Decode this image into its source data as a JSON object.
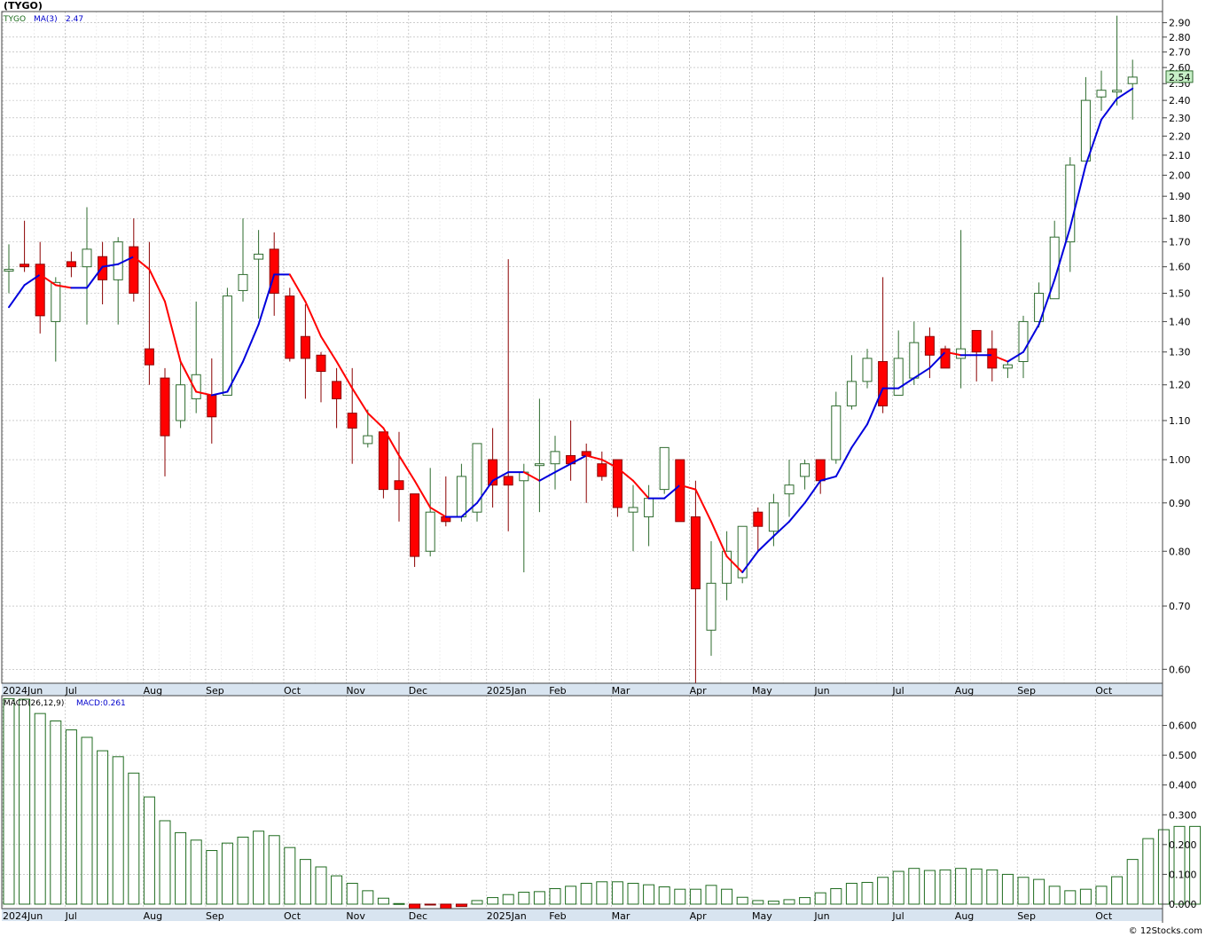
{
  "header": {
    "title": "(TYGO)"
  },
  "legend": {
    "symbol": "TYGO",
    "ma_label": "MA(3)",
    "ma_value": "2.47",
    "macd_params": "MACD(26,12,9)",
    "macd_value": "MACD:0.261"
  },
  "last_price_label": "2.54",
  "watermark": "© 12Stocks.com",
  "colors": {
    "up": "#2e6b2e",
    "down": "#ff0000",
    "ma_up": "#0000dd",
    "ma_down": "#ff0000",
    "macd_bar": "#1f6b1f",
    "price_box": "#c8f0c8",
    "axis_band": "#d8e4f0"
  },
  "chart_data": [
    {
      "type": "candlestick",
      "symbol": "TYGO",
      "scale": "log",
      "ylim": [
        0.58,
        2.98
      ],
      "yticks": [
        0.6,
        0.7,
        0.8,
        0.9,
        1.0,
        1.1,
        1.2,
        1.3,
        1.4,
        1.5,
        1.6,
        1.7,
        1.8,
        1.9,
        2.0,
        2.1,
        2.2,
        2.3,
        2.4,
        2.5,
        2.6,
        2.7,
        2.8,
        2.9
      ],
      "ytick_labels": [
        "0.60",
        "0.70",
        "0.80",
        "0.90",
        "1.00",
        "1.10",
        "1.20",
        "1.30",
        "1.40",
        "1.50",
        "1.60",
        "1.70",
        "1.80",
        "1.90",
        "2.00",
        "2.10",
        "2.20",
        "2.30",
        "2.40",
        "2.50",
        "2.60",
        "2.70",
        "2.80",
        "2.90"
      ],
      "months": [
        {
          "label": "2024Jun",
          "week": 0
        },
        {
          "label": "Jul",
          "week": 4
        },
        {
          "label": "Aug",
          "week": 9
        },
        {
          "label": "Sep",
          "week": 13
        },
        {
          "label": "Oct",
          "week": 18
        },
        {
          "label": "Nov",
          "week": 22
        },
        {
          "label": "Dec",
          "week": 26
        },
        {
          "label": "2025Jan",
          "week": 31
        },
        {
          "label": "Feb",
          "week": 35
        },
        {
          "label": "Mar",
          "week": 39
        },
        {
          "label": "Apr",
          "week": 44
        },
        {
          "label": "May",
          "week": 48
        },
        {
          "label": "Jun",
          "week": 52
        },
        {
          "label": "Jul",
          "week": 57
        },
        {
          "label": "Aug",
          "week": 61
        },
        {
          "label": "Sep",
          "week": 65
        },
        {
          "label": "Oct",
          "week": 70
        }
      ],
      "candles": [
        {
          "o": 1.59,
          "h": 1.69,
          "l": 1.5,
          "c": 1.59
        },
        {
          "o": 1.61,
          "h": 1.79,
          "l": 1.58,
          "c": 1.6
        },
        {
          "o": 1.61,
          "h": 1.7,
          "l": 1.36,
          "c": 1.42
        },
        {
          "o": 1.4,
          "h": 1.56,
          "l": 1.27,
          "c": 1.54
        },
        {
          "o": 1.62,
          "h": 1.66,
          "l": 1.56,
          "c": 1.6
        },
        {
          "o": 1.6,
          "h": 1.85,
          "l": 1.39,
          "c": 1.67
        },
        {
          "o": 1.64,
          "h": 1.7,
          "l": 1.46,
          "c": 1.55
        },
        {
          "o": 1.55,
          "h": 1.72,
          "l": 1.39,
          "c": 1.7
        },
        {
          "o": 1.68,
          "h": 1.8,
          "l": 1.47,
          "c": 1.5
        },
        {
          "o": 1.31,
          "h": 1.7,
          "l": 1.2,
          "c": 1.26
        },
        {
          "o": 1.22,
          "h": 1.25,
          "l": 0.96,
          "c": 1.06
        },
        {
          "o": 1.1,
          "h": 1.27,
          "l": 1.08,
          "c": 1.2
        },
        {
          "o": 1.16,
          "h": 1.47,
          "l": 1.12,
          "c": 1.23
        },
        {
          "o": 1.17,
          "h": 1.28,
          "l": 1.04,
          "c": 1.11
        },
        {
          "o": 1.17,
          "h": 1.52,
          "l": 1.17,
          "c": 1.49
        },
        {
          "o": 1.51,
          "h": 1.8,
          "l": 1.47,
          "c": 1.57
        },
        {
          "o": 1.63,
          "h": 1.75,
          "l": 1.41,
          "c": 1.65
        },
        {
          "o": 1.67,
          "h": 1.74,
          "l": 1.42,
          "c": 1.5
        },
        {
          "o": 1.49,
          "h": 1.52,
          "l": 1.27,
          "c": 1.28
        },
        {
          "o": 1.35,
          "h": 1.46,
          "l": 1.16,
          "c": 1.28
        },
        {
          "o": 1.29,
          "h": 1.3,
          "l": 1.15,
          "c": 1.24
        },
        {
          "o": 1.21,
          "h": 1.25,
          "l": 1.08,
          "c": 1.16
        },
        {
          "o": 1.12,
          "h": 1.25,
          "l": 0.99,
          "c": 1.08
        },
        {
          "o": 1.04,
          "h": 1.13,
          "l": 1.03,
          "c": 1.06
        },
        {
          "o": 1.07,
          "h": 1.07,
          "l": 0.91,
          "c": 0.93
        },
        {
          "o": 0.95,
          "h": 1.07,
          "l": 0.86,
          "c": 0.93
        },
        {
          "o": 0.92,
          "h": 0.92,
          "l": 0.77,
          "c": 0.79
        },
        {
          "o": 0.8,
          "h": 0.98,
          "l": 0.79,
          "c": 0.88
        },
        {
          "o": 0.87,
          "h": 0.96,
          "l": 0.85,
          "c": 0.86
        },
        {
          "o": 0.87,
          "h": 0.99,
          "l": 0.86,
          "c": 0.96
        },
        {
          "o": 0.88,
          "h": 1.04,
          "l": 0.86,
          "c": 1.04
        },
        {
          "o": 1.0,
          "h": 1.08,
          "l": 0.89,
          "c": 0.94
        },
        {
          "o": 0.96,
          "h": 1.63,
          "l": 0.84,
          "c": 0.94
        },
        {
          "o": 0.95,
          "h": 0.99,
          "l": 0.76,
          "c": 0.97
        },
        {
          "o": 0.99,
          "h": 1.16,
          "l": 0.88,
          "c": 0.99
        },
        {
          "o": 0.99,
          "h": 1.06,
          "l": 0.93,
          "c": 1.02
        },
        {
          "o": 1.01,
          "h": 1.1,
          "l": 0.95,
          "c": 0.99
        },
        {
          "o": 1.02,
          "h": 1.04,
          "l": 0.9,
          "c": 1.01
        },
        {
          "o": 0.99,
          "h": 1.02,
          "l": 0.95,
          "c": 0.96
        },
        {
          "o": 1.0,
          "h": 1.0,
          "l": 0.87,
          "c": 0.89
        },
        {
          "o": 0.88,
          "h": 0.94,
          "l": 0.8,
          "c": 0.89
        },
        {
          "o": 0.87,
          "h": 0.94,
          "l": 0.81,
          "c": 0.91
        },
        {
          "o": 0.93,
          "h": 1.03,
          "l": 0.92,
          "c": 1.03
        },
        {
          "o": 1.0,
          "h": 1.0,
          "l": 0.86,
          "c": 0.86
        },
        {
          "o": 0.87,
          "h": 0.95,
          "l": 0.58,
          "c": 0.73
        },
        {
          "o": 0.66,
          "h": 0.82,
          "l": 0.62,
          "c": 0.74
        },
        {
          "o": 0.74,
          "h": 0.84,
          "l": 0.71,
          "c": 0.8
        },
        {
          "o": 0.75,
          "h": 0.85,
          "l": 0.74,
          "c": 0.85
        },
        {
          "o": 0.88,
          "h": 0.89,
          "l": 0.8,
          "c": 0.85
        },
        {
          "o": 0.84,
          "h": 0.92,
          "l": 0.81,
          "c": 0.9
        },
        {
          "o": 0.92,
          "h": 1.0,
          "l": 0.87,
          "c": 0.94
        },
        {
          "o": 0.96,
          "h": 1.0,
          "l": 0.93,
          "c": 0.99
        },
        {
          "o": 1.0,
          "h": 1.0,
          "l": 0.92,
          "c": 0.95
        },
        {
          "o": 1.0,
          "h": 1.18,
          "l": 0.99,
          "c": 1.14
        },
        {
          "o": 1.14,
          "h": 1.29,
          "l": 1.13,
          "c": 1.21
        },
        {
          "o": 1.21,
          "h": 1.31,
          "l": 1.19,
          "c": 1.28
        },
        {
          "o": 1.27,
          "h": 1.56,
          "l": 1.12,
          "c": 1.14
        },
        {
          "o": 1.17,
          "h": 1.37,
          "l": 1.17,
          "c": 1.28
        },
        {
          "o": 1.22,
          "h": 1.4,
          "l": 1.2,
          "c": 1.33
        },
        {
          "o": 1.35,
          "h": 1.38,
          "l": 1.22,
          "c": 1.29
        },
        {
          "o": 1.31,
          "h": 1.32,
          "l": 1.25,
          "c": 1.25
        },
        {
          "o": 1.28,
          "h": 1.75,
          "l": 1.19,
          "c": 1.31
        },
        {
          "o": 1.37,
          "h": 1.37,
          "l": 1.21,
          "c": 1.3
        },
        {
          "o": 1.31,
          "h": 1.37,
          "l": 1.21,
          "c": 1.25
        },
        {
          "o": 1.25,
          "h": 1.27,
          "l": 1.22,
          "c": 1.26
        },
        {
          "o": 1.27,
          "h": 1.42,
          "l": 1.22,
          "c": 1.4
        },
        {
          "o": 1.4,
          "h": 1.54,
          "l": 1.38,
          "c": 1.5
        },
        {
          "o": 1.48,
          "h": 1.79,
          "l": 1.48,
          "c": 1.72
        },
        {
          "o": 1.7,
          "h": 2.09,
          "l": 1.58,
          "c": 2.05
        },
        {
          "o": 2.07,
          "h": 2.54,
          "l": 2.07,
          "c": 2.4
        },
        {
          "o": 2.42,
          "h": 2.58,
          "l": 2.34,
          "c": 2.46
        },
        {
          "o": 2.45,
          "h": 2.95,
          "l": 2.37,
          "c": 2.46
        },
        {
          "o": 2.5,
          "h": 2.65,
          "l": 2.29,
          "c": 2.54
        }
      ],
      "ma_label": "MA(3)",
      "ma": [
        1.45,
        1.53,
        1.57,
        1.53,
        1.52,
        1.52,
        1.6,
        1.61,
        1.64,
        1.59,
        1.47,
        1.27,
        1.18,
        1.17,
        1.18,
        1.27,
        1.39,
        1.57,
        1.57,
        1.47,
        1.35,
        1.27,
        1.19,
        1.12,
        1.08,
        1.01,
        0.95,
        0.89,
        0.87,
        0.87,
        0.9,
        0.95,
        0.97,
        0.97,
        0.95,
        0.97,
        0.99,
        1.01,
        1.0,
        0.98,
        0.95,
        0.91,
        0.91,
        0.94,
        0.93,
        0.86,
        0.79,
        0.76,
        0.8,
        0.83,
        0.86,
        0.9,
        0.95,
        0.96,
        1.03,
        1.09,
        1.19,
        1.19,
        1.22,
        1.25,
        1.3,
        1.29,
        1.29,
        1.29,
        1.27,
        1.3,
        1.39,
        1.55,
        1.76,
        2.05,
        2.29,
        2.41,
        2.47
      ]
    },
    {
      "type": "bar",
      "label": "MACD(26,12,9)",
      "value_label": "MACD:0.261",
      "ylim": [
        -0.015,
        0.7
      ],
      "yticks": [
        0.0,
        0.1,
        0.2,
        0.3,
        0.4,
        0.5,
        0.6
      ],
      "ytick_labels": [
        "0.000",
        "0.100",
        "0.200",
        "0.300",
        "0.400",
        "0.500",
        "0.600"
      ],
      "values": [
        0.69,
        0.688,
        0.64,
        0.615,
        0.585,
        0.56,
        0.515,
        0.495,
        0.44,
        0.36,
        0.28,
        0.24,
        0.215,
        0.18,
        0.205,
        0.225,
        0.245,
        0.23,
        0.19,
        0.15,
        0.125,
        0.095,
        0.07,
        0.045,
        0.02,
        0.002,
        -0.02,
        -0.002,
        -0.02,
        -0.008,
        0.012,
        0.022,
        0.032,
        0.04,
        0.042,
        0.052,
        0.06,
        0.07,
        0.075,
        0.075,
        0.07,
        0.065,
        0.058,
        0.05,
        0.05,
        0.063,
        0.05,
        0.023,
        0.012,
        0.01,
        0.015,
        0.022,
        0.038,
        0.052,
        0.07,
        0.073,
        0.09,
        0.11,
        0.12,
        0.113,
        0.115,
        0.12,
        0.118,
        0.115,
        0.1,
        0.09,
        0.083,
        0.06,
        0.045,
        0.05,
        0.06,
        0.092,
        0.15,
        0.22,
        0.25,
        0.261,
        0.261
      ]
    }
  ]
}
